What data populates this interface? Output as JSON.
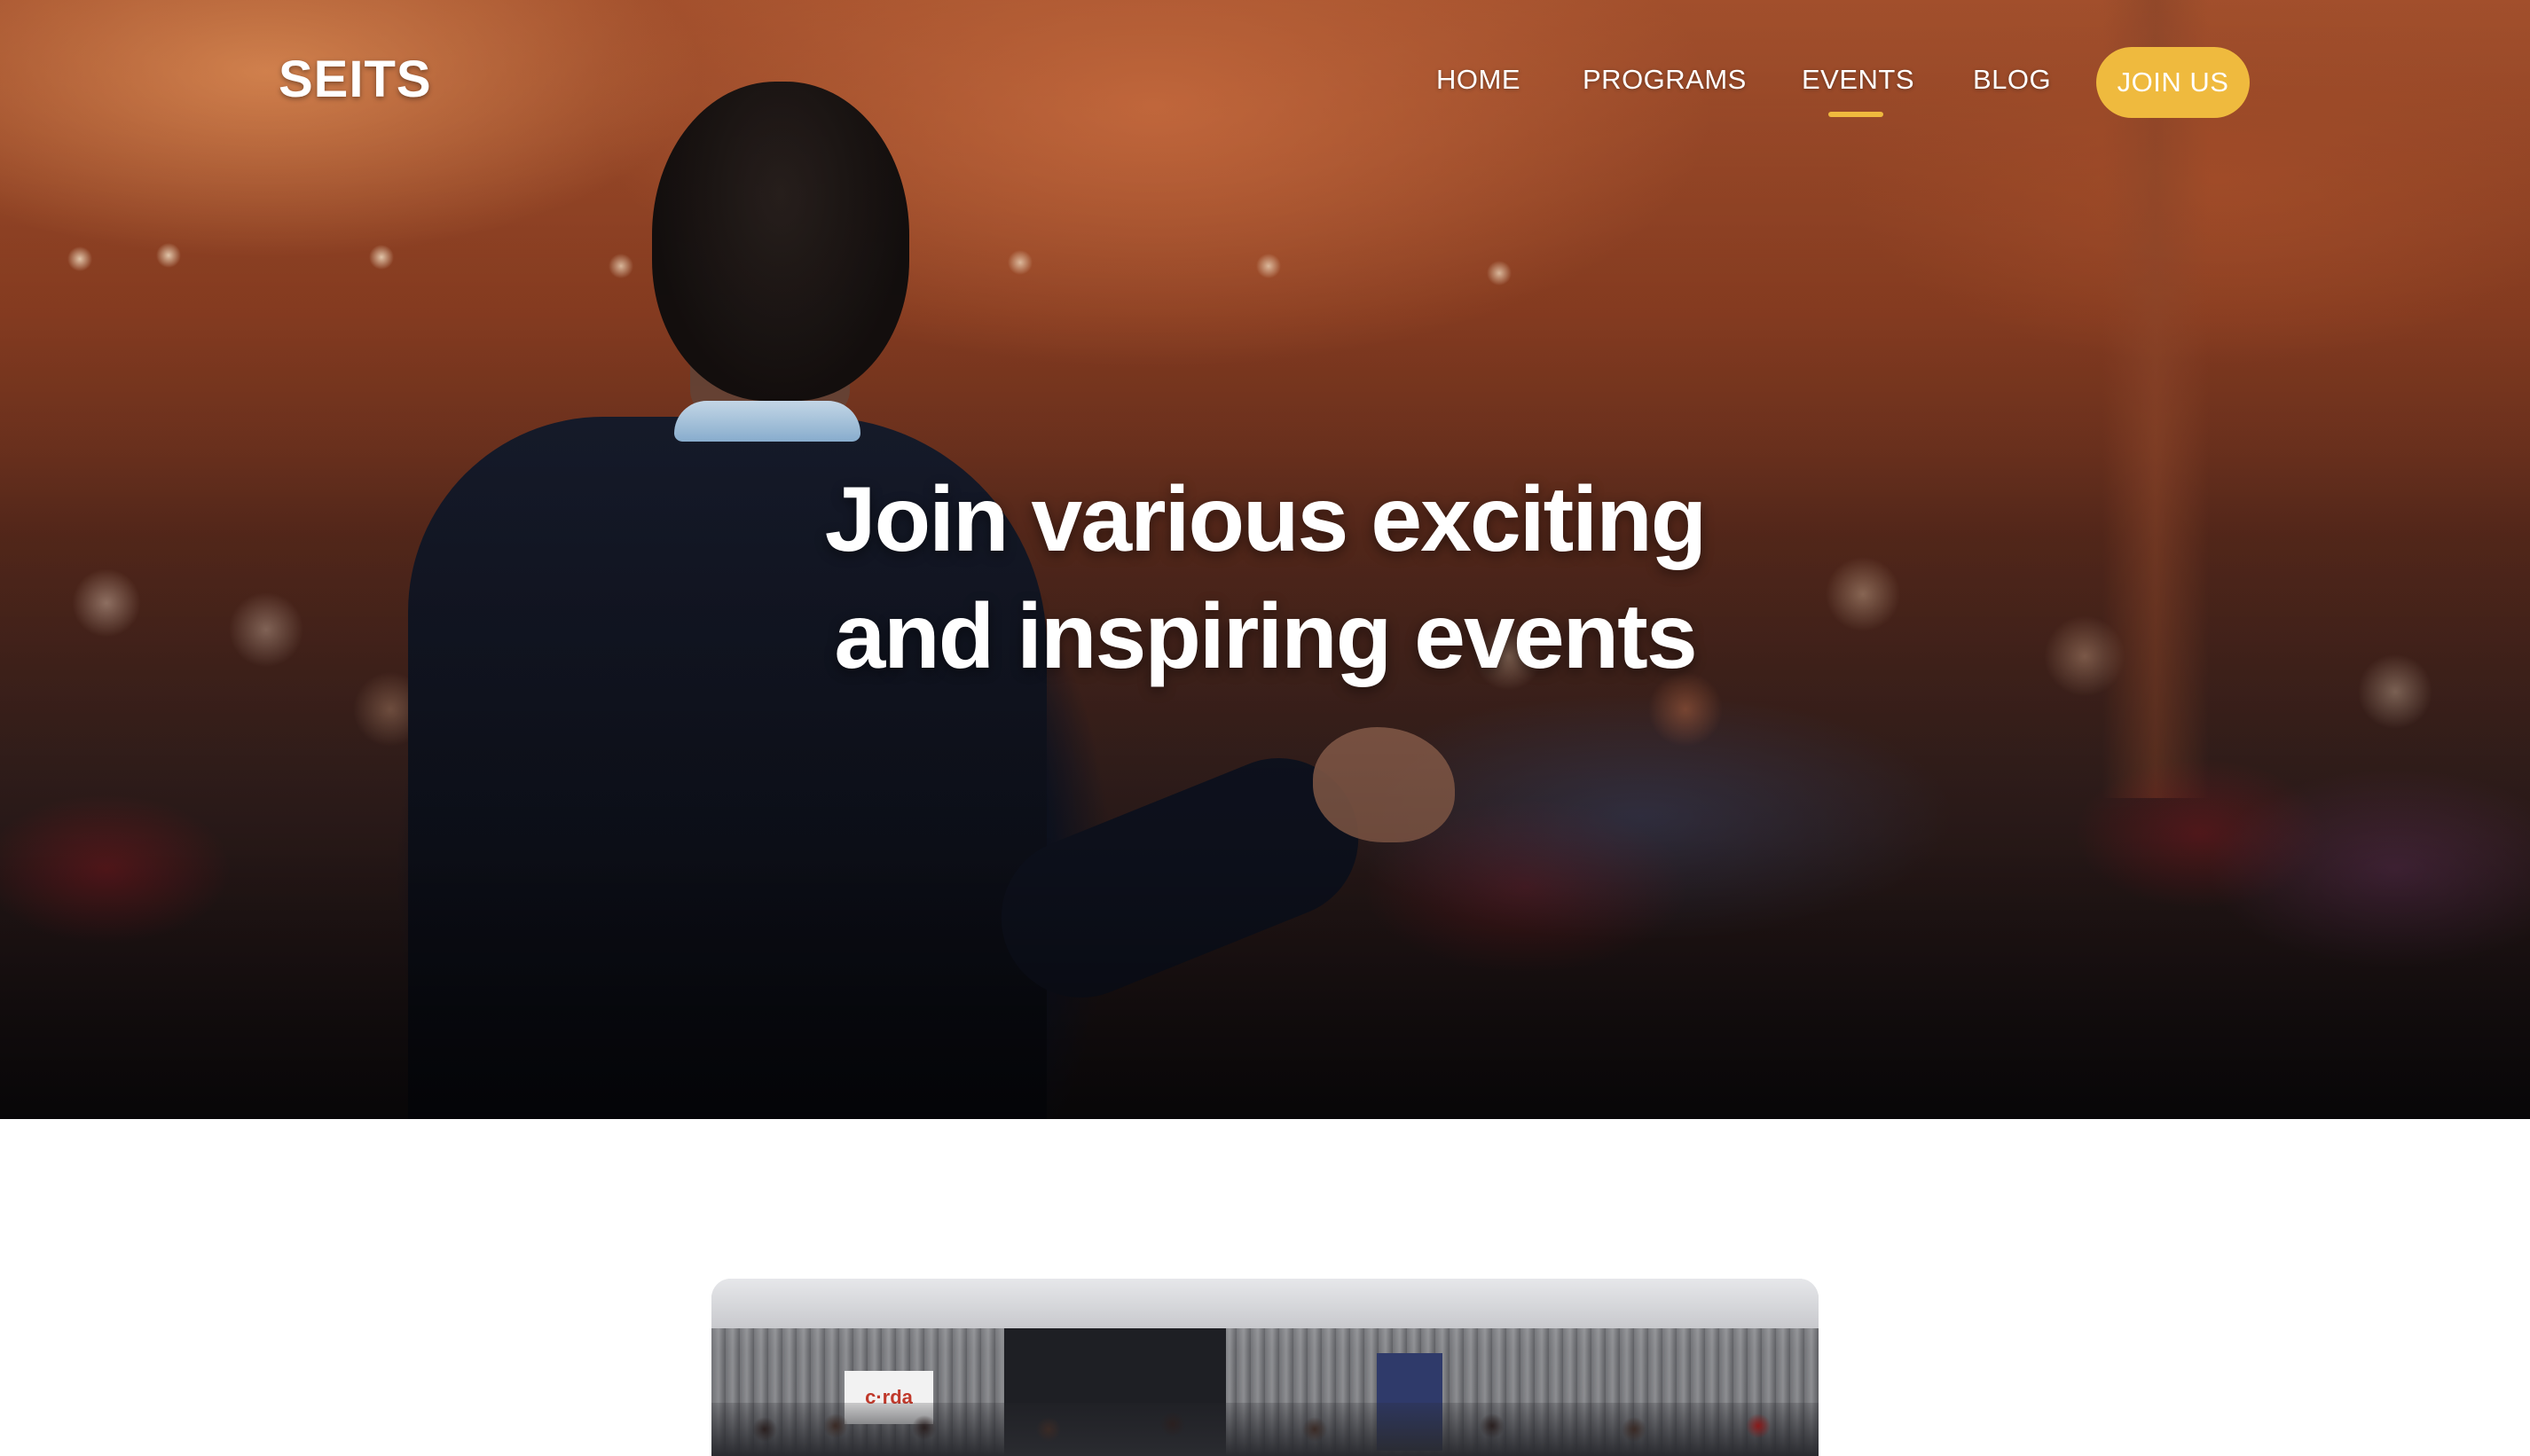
{
  "brand": {
    "logo_text": "SEITS"
  },
  "nav": {
    "items": [
      {
        "label": "HOME"
      },
      {
        "label": "PROGRAMS"
      },
      {
        "label": "EVENTS",
        "active": true
      },
      {
        "label": "BLOG"
      }
    ],
    "cta_label": "JOIN US"
  },
  "hero": {
    "title_line1": "Join various exciting",
    "title_line2": "and inspiring events"
  },
  "event_card": {
    "banner_text": "c·rda"
  },
  "colors": {
    "accent": "#efba3e",
    "text_on_hero": "#ffffff",
    "page_background": "#ffffff"
  },
  "icons": []
}
